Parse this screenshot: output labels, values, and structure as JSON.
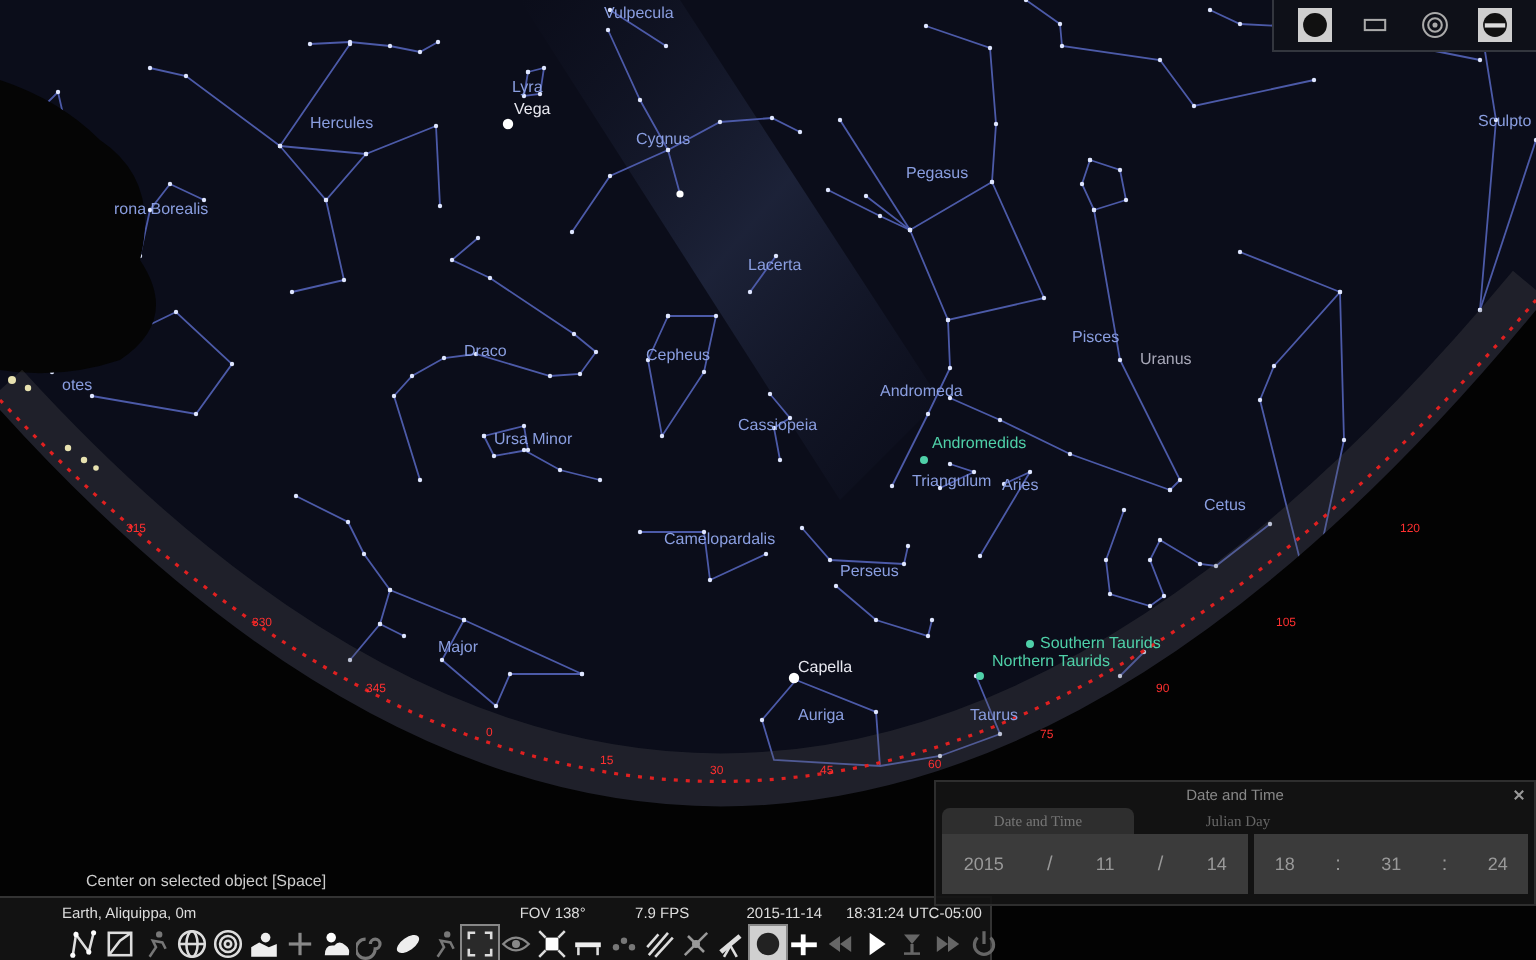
{
  "sky_labels": [
    {
      "kind": "constellation",
      "text": "Vulpecula"
    },
    {
      "kind": "constellation",
      "text": "Lyra"
    },
    {
      "kind": "star",
      "text": "Vega"
    },
    {
      "kind": "constellation",
      "text": "Hercules"
    },
    {
      "kind": "constellation",
      "text": "Cygnus"
    },
    {
      "kind": "constellation",
      "text": "Pegasus"
    },
    {
      "kind": "constellation",
      "text": "Sculpto"
    },
    {
      "kind": "constellation",
      "text": "rona Borealis"
    },
    {
      "kind": "constellation",
      "text": "Lacerta"
    },
    {
      "kind": "constellation",
      "text": "Pisces"
    },
    {
      "kind": "planet",
      "text": "Uranus"
    },
    {
      "kind": "constellation",
      "text": "Draco"
    },
    {
      "kind": "constellation",
      "text": "Cepheus"
    },
    {
      "kind": "constellation",
      "text": "otes"
    },
    {
      "kind": "constellation",
      "text": "Andromeda"
    },
    {
      "kind": "constellation",
      "text": "Cassiopeia"
    },
    {
      "kind": "constellation",
      "text": "Ursa Minor"
    },
    {
      "kind": "meteor_shower",
      "text": "Andromedids"
    },
    {
      "kind": "constellation",
      "text": "Triangulum"
    },
    {
      "kind": "constellation",
      "text": "Aries"
    },
    {
      "kind": "constellation",
      "text": "Cetus"
    },
    {
      "kind": "constellation",
      "text": "Camelopardalis"
    },
    {
      "kind": "constellation",
      "text": "Perseus"
    },
    {
      "kind": "constellation",
      "text": "Major"
    },
    {
      "kind": "meteor_shower",
      "text": "Southern Taurids"
    },
    {
      "kind": "meteor_shower",
      "text": "Northern Taurids"
    },
    {
      "kind": "star",
      "text": "Capella"
    },
    {
      "kind": "constellation",
      "text": "Auriga"
    },
    {
      "kind": "constellation",
      "text": "Taurus"
    }
  ],
  "azimuth_labels": [
    "315",
    "330",
    "345",
    "0",
    "15",
    "30",
    "45",
    "60",
    "75",
    "90",
    "105",
    "120"
  ],
  "view_panel": [
    {
      "selected": true
    },
    {
      "selected": false
    },
    {
      "selected": false
    },
    {
      "selected": true
    }
  ],
  "tooltip": "Center on selected object  [Space]",
  "status_bar": {
    "location": "Earth, Aliquippa, 0m",
    "fov": "FOV 138°",
    "fps": "7.9 FPS",
    "date": "2015-11-14",
    "time": "18:31:24 UTC-05:00"
  },
  "toolbar": [
    {
      "selected": false
    },
    {
      "selected": false
    },
    {
      "selected": false
    },
    {
      "selected": false
    },
    {
      "selected": false
    },
    {
      "selected": false
    },
    {
      "selected": false
    },
    {
      "selected": false
    },
    {
      "selected": false
    },
    {
      "selected": false
    },
    {
      "selected": false
    },
    {
      "selected": true
    },
    {
      "selected": false
    },
    {
      "selected": false
    },
    {
      "selected": false
    },
    {
      "selected": false
    },
    {
      "selected": false
    },
    {
      "selected": false
    },
    {
      "selected": false
    },
    {
      "selected": true
    },
    {
      "selected": false
    }
  ],
  "time_controls": [
    {
      "selected": false
    },
    {
      "selected": false
    },
    {
      "selected": false
    },
    {
      "selected": false
    },
    {
      "selected": false
    }
  ],
  "date_dialog": {
    "title": "Date and Time",
    "tabs": [
      {
        "label": "Date and Time",
        "selected": true
      },
      {
        "label": "Julian Day",
        "selected": false
      }
    ],
    "date": {
      "year": "2015",
      "sep1": "/",
      "month": "11",
      "sep2": "/",
      "day": "14"
    },
    "time": {
      "hour": "18",
      "sep1": ":",
      "minute": "31",
      "sep2": ":",
      "second": "24"
    }
  }
}
